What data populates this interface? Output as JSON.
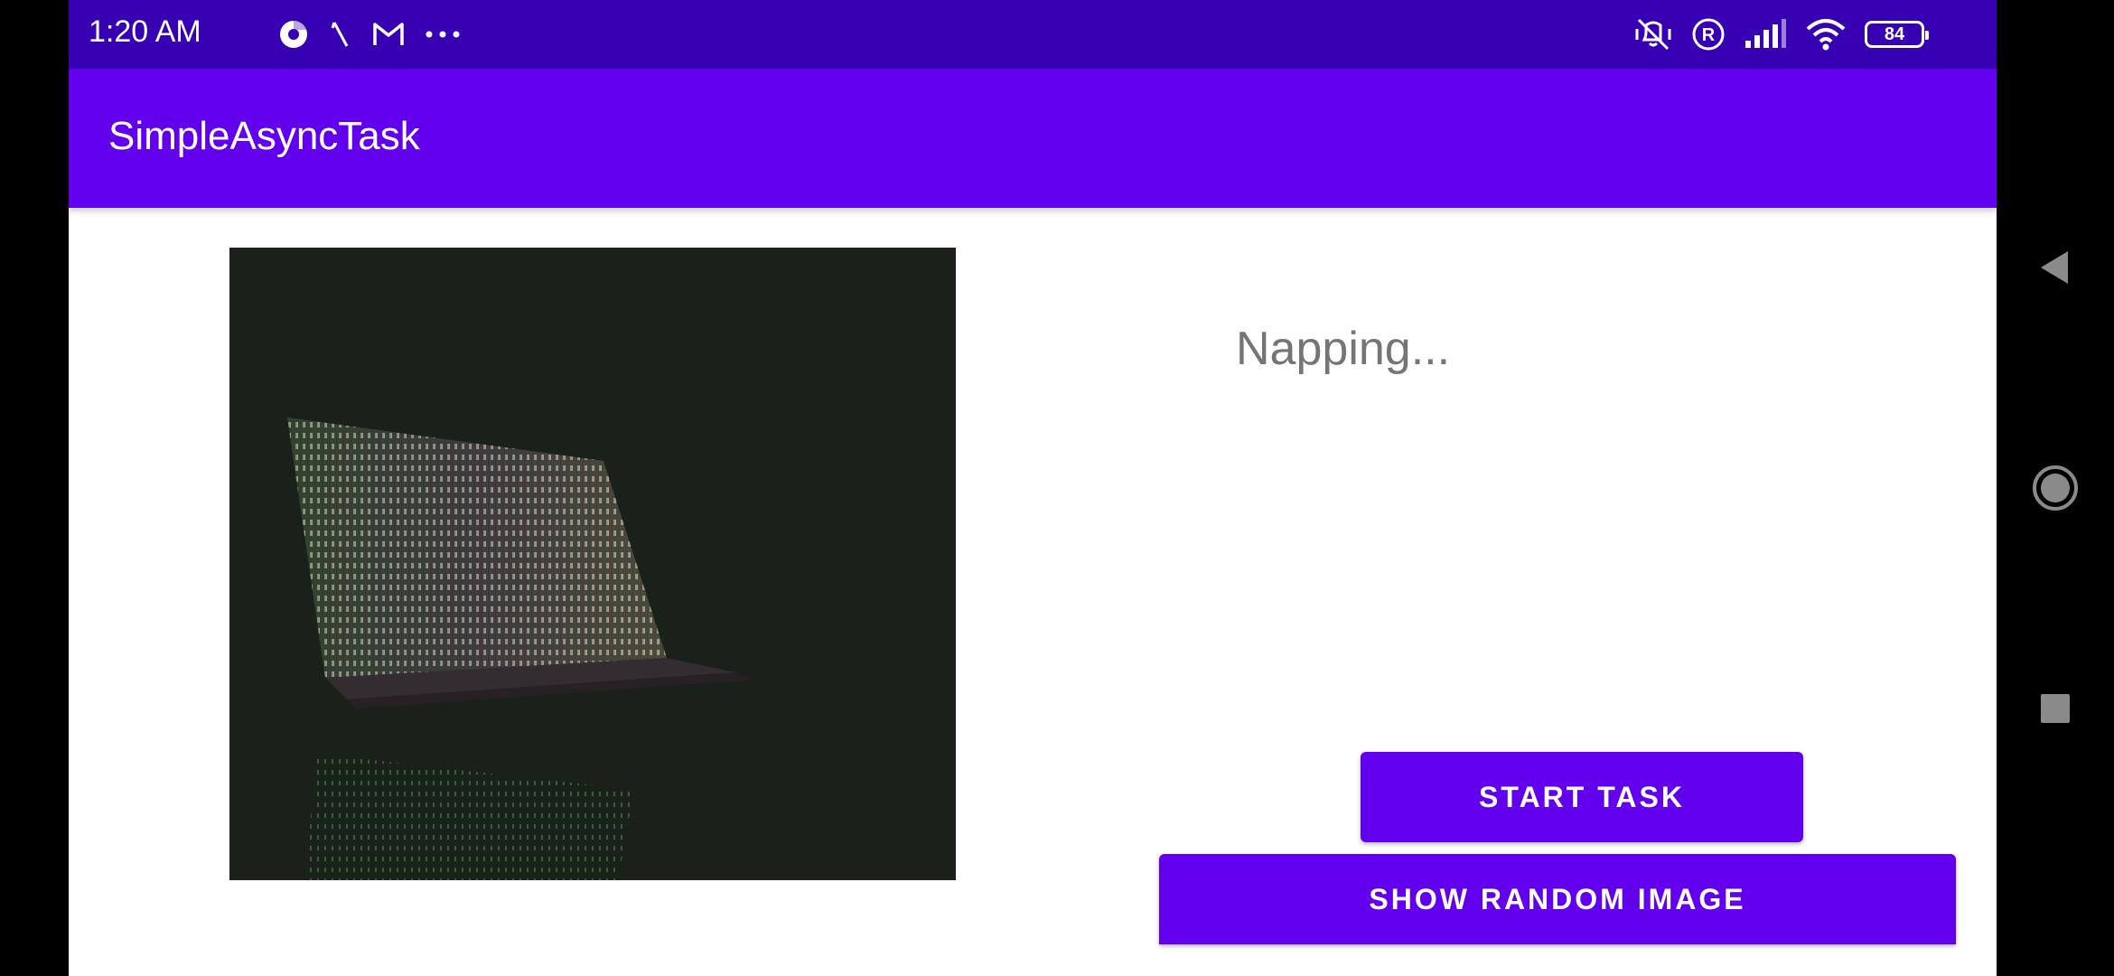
{
  "status_bar": {
    "time": "1:20 AM",
    "left_icons": [
      "chrome-icon",
      "slash-icon",
      "gmail-icon",
      "more-dots-icon"
    ],
    "right_icons": [
      "vibrate-off-icon",
      "registered-icon",
      "signal-icon",
      "wifi-icon"
    ],
    "battery_level": "84"
  },
  "app_bar": {
    "title": "SimpleAsyncTask",
    "color": "#6200ee"
  },
  "main": {
    "image_description_icon": "laptop-matrix-image",
    "status_text": "Napping...",
    "start_button_label": "START TASK",
    "random_image_button_label": "SHOW RANDOM IMAGE"
  },
  "nav": {
    "icons": [
      "back-icon",
      "home-icon",
      "recents-icon"
    ]
  },
  "colors": {
    "status_bar": "#3700b3",
    "primary": "#6200ee",
    "status_text": "#757575"
  }
}
